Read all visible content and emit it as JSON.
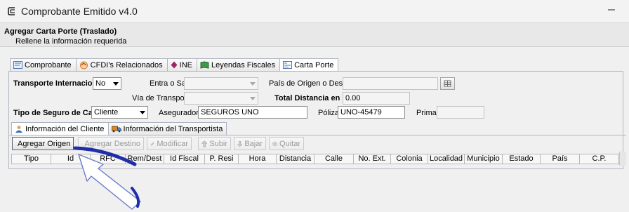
{
  "window": {
    "title": "Comprobante Emitido v4.0"
  },
  "header": {
    "title": "Agregar Carta Porte (Traslado)",
    "subtitle": "Rellene la información requerida"
  },
  "tabs": [
    {
      "label": "Comprobante",
      "icon": "document-icon"
    },
    {
      "label": "CFDI's Relacionados",
      "icon": "related-docs-icon"
    },
    {
      "label": "INE",
      "icon": "diamond-icon"
    },
    {
      "label": "Leyendas Fiscales",
      "icon": "book-icon"
    },
    {
      "label": "Carta Porte",
      "icon": "form-icon",
      "active": true
    }
  ],
  "form": {
    "transporte_internacional": {
      "label": "Transporte Internacional",
      "value": "No"
    },
    "entra_o_sale": {
      "label": "Entra o Sale",
      "value": ""
    },
    "pais_origen_destino": {
      "label": "País de Origen o Destino",
      "value": ""
    },
    "via_transporte": {
      "label": "Vía de Transporte",
      "value": ""
    },
    "total_distancia": {
      "label": "Total Distancia en KM",
      "value": "0.00"
    },
    "tipo_seguro": {
      "label": "Tipo de Seguro de Carga",
      "value": "Cliente"
    },
    "aseguradora": {
      "label": "Aseguradora",
      "value": "SEGUROS UNO"
    },
    "poliza": {
      "label": "Póliza",
      "value": "UNO-45479"
    },
    "prima": {
      "label": "Prima",
      "value": ""
    }
  },
  "subtabs": [
    {
      "label": "Información del Cliente",
      "icon": "person-icon",
      "active": true
    },
    {
      "label": "Información del Transportista",
      "icon": "truck-icon"
    }
  ],
  "toolbar": {
    "agregar_origen": "Agregar Origen",
    "agregar_destino": "Agregar Destino",
    "modificar": "Modificar",
    "subir": "Subir",
    "bajar": "Bajar",
    "quitar": "Quitar"
  },
  "grid": {
    "columns": [
      "Tipo",
      "Id",
      "RFC",
      "Rem/Dest",
      "Id Fiscal",
      "P. Resi",
      "Hora",
      "Distancia",
      "Calle",
      "No. Ext.",
      "Colonia",
      "Localidad",
      "Municipio",
      "Estado",
      "País",
      "C.P."
    ]
  },
  "colors": {
    "annotation_arrow": "#1f2fa8",
    "tab_border": "#aeb6c2",
    "panel_bg": "#f0f0f0"
  }
}
